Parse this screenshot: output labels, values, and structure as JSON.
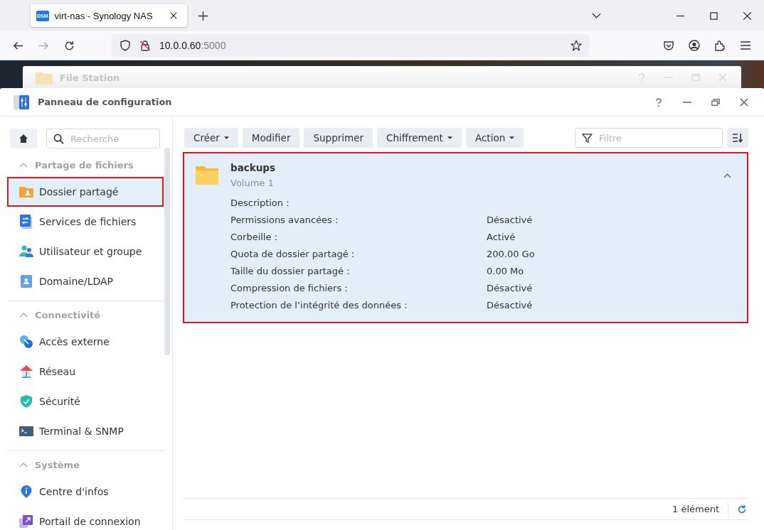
{
  "browser": {
    "tab_title": "virt-nas - Synology NAS",
    "tab_badge": "DSM",
    "url_host": "10.0.0.60",
    "url_port": ":5000"
  },
  "background_window": {
    "title": "File Station"
  },
  "window": {
    "title": "Panneau de configuration"
  },
  "sidebar": {
    "search_placeholder": "Recherche",
    "sections": [
      {
        "title": "Partage de fichiers",
        "expanded": true,
        "items": [
          {
            "label": "Dossier partagé",
            "kind": "shared-folder",
            "selected": true,
            "highlighted": true
          },
          {
            "label": "Services de fichiers",
            "kind": "file-services",
            "selected": false,
            "highlighted": false
          },
          {
            "label": "Utilisateur et groupe",
            "kind": "users",
            "selected": false,
            "highlighted": false
          },
          {
            "label": "Domaine/LDAP",
            "kind": "domain",
            "selected": false,
            "highlighted": false
          }
        ]
      },
      {
        "title": "Connectivité",
        "expanded": true,
        "items": [
          {
            "label": "Accès externe",
            "kind": "external",
            "selected": false,
            "highlighted": false
          },
          {
            "label": "Réseau",
            "kind": "network",
            "selected": false,
            "highlighted": false
          },
          {
            "label": "Sécurité",
            "kind": "security",
            "selected": false,
            "highlighted": false
          },
          {
            "label": "Terminal & SNMP",
            "kind": "terminal",
            "selected": false,
            "highlighted": false
          }
        ]
      },
      {
        "title": "Système",
        "expanded": true,
        "items": [
          {
            "label": "Centre d'infos",
            "kind": "info",
            "selected": false,
            "highlighted": false
          },
          {
            "label": "Portail de connexion",
            "kind": "portal",
            "selected": false,
            "highlighted": false
          }
        ]
      }
    ]
  },
  "toolbar": {
    "buttons": [
      {
        "label": "Créer",
        "dropdown": true
      },
      {
        "label": "Modifier",
        "dropdown": false
      },
      {
        "label": "Supprimer",
        "dropdown": false
      },
      {
        "label": "Chiffrement",
        "dropdown": true
      },
      {
        "label": "Action",
        "dropdown": true
      }
    ],
    "filter_placeholder": "Filtre"
  },
  "folders": [
    {
      "name": "backups",
      "volume": "Volume 1",
      "expanded": true,
      "highlighted": true,
      "details": [
        {
          "label": "Description :"
        },
        {
          "label": "Permissions avancées :",
          "value": "Désactivé"
        },
        {
          "label": "Corbeille :",
          "value": "Activé"
        },
        {
          "label": "Quota de dossier partagé :",
          "value": "200.00 Go"
        },
        {
          "label": "Taille du dossier partagé :",
          "value": "0.00 Mo"
        },
        {
          "label": "Compression de fichiers :",
          "value": "Désactivé"
        },
        {
          "label": "Protection de l’intégrité des données :",
          "value": "Désactivé"
        }
      ]
    }
  ],
  "status": {
    "count": "1 élément"
  }
}
